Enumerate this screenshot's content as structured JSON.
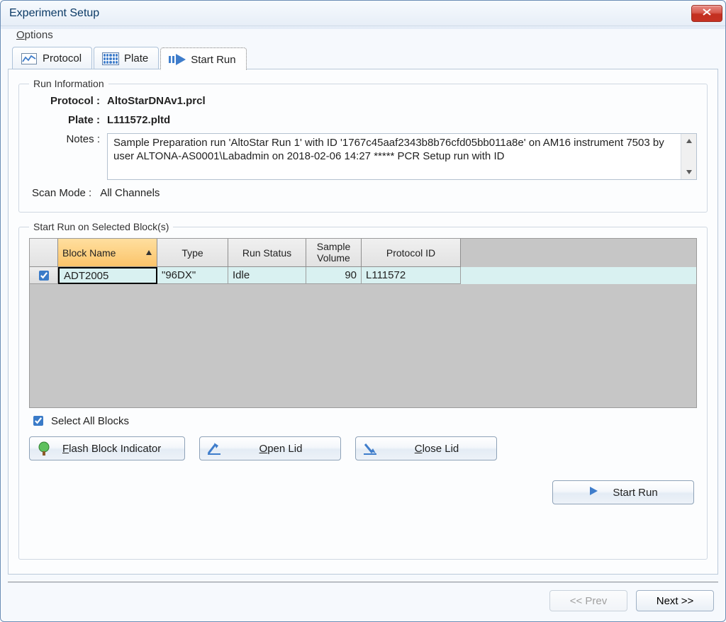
{
  "window": {
    "title": "Experiment Setup"
  },
  "menu": {
    "options": "Options"
  },
  "tabs": {
    "protocol": "Protocol",
    "plate": "Plate",
    "startrun": "Start Run"
  },
  "runinfo": {
    "legend": "Run Information",
    "protocol_label": "Protocol  :",
    "protocol_value": "AltoStarDNAv1.prcl",
    "plate_label": "Plate  :",
    "plate_value": "L111572.pltd",
    "notes_label": "Notes  :",
    "notes_text": "Sample Preparation run 'AltoStar Run 1' with ID '1767c45aaf2343b8b76cfd05bb011a8e' on AM16 instrument 7503 by user ALTONA-AS0001\\Labadmin on 2018-02-06 14:27  *****  PCR Setup run with ID"
  },
  "scan_mode": {
    "label": "Scan Mode  :",
    "value": "All Channels"
  },
  "blocks": {
    "legend": "Start Run on Selected Block(s)",
    "columns": {
      "block_name": "Block Name",
      "type": "Type",
      "run_status": "Run Status",
      "sample_volume": "Sample Volume",
      "protocol_id": "Protocol ID"
    },
    "rows": [
      {
        "checked": true,
        "block_name": "ADT2005",
        "type": "\"96DX\"",
        "run_status": "Idle",
        "sample_volume": "90",
        "protocol_id": "L111572"
      }
    ],
    "select_all_label": "Select All Blocks"
  },
  "buttons": {
    "flash": "Flash Block Indicator",
    "open_lid": "Open Lid",
    "close_lid": "Close Lid",
    "start_run": "Start Run",
    "prev": "<< Prev",
    "next": "Next >>"
  }
}
